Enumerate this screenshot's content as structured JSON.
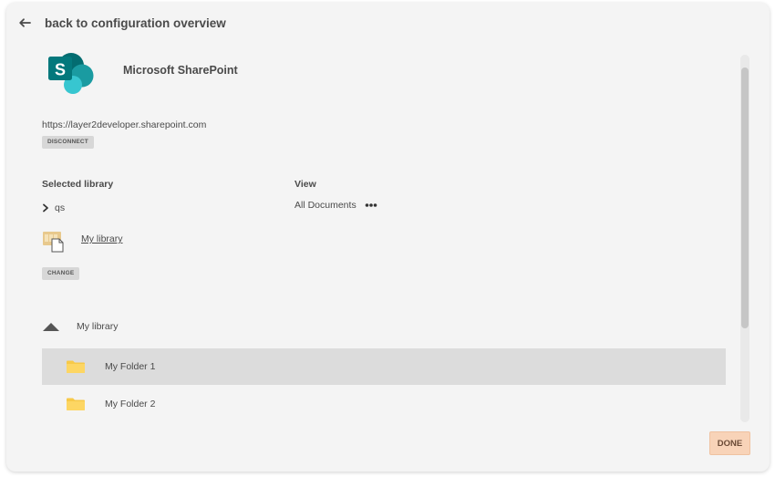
{
  "header": {
    "back_label": "back to configuration overview"
  },
  "connection": {
    "service_name": "Microsoft SharePoint",
    "site_url": "https://layer2developer.sharepoint.com",
    "disconnect_label": "DISCONNECT"
  },
  "library": {
    "selected_label": "Selected library",
    "tree_node": "qs",
    "library_name": "My library",
    "change_label": "CHANGE"
  },
  "view": {
    "label": "View",
    "value": "All Documents"
  },
  "folders": {
    "root_label": "My library",
    "items": [
      {
        "name": "My Folder 1",
        "selected": true
      },
      {
        "name": "My Folder 2",
        "selected": false
      }
    ]
  },
  "footer": {
    "done_label": "DONE"
  },
  "colors": {
    "panel_bg": "#f4f4f4",
    "selected_row": "#dcdcdc",
    "done_button": "#f8d3b8",
    "folder_yellow": "#f7c948",
    "sharepoint_teal": "#038387"
  },
  "icons": {
    "back": "arrow-left-icon",
    "logo": "sharepoint-logo-icon",
    "chevron": "chevron-right-icon",
    "more": "more-horizontal-icon",
    "library": "library-document-icon",
    "collapse": "triangle-up-icon",
    "folder": "folder-icon"
  }
}
